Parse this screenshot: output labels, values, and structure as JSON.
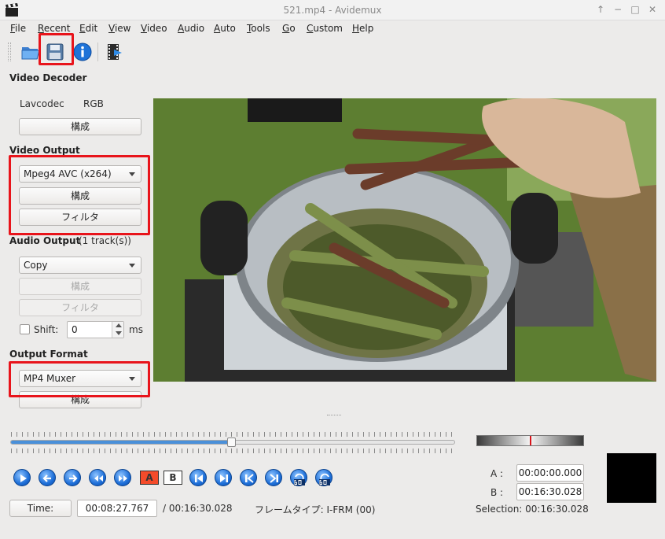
{
  "window": {
    "title": "521.mp4 - Avidemux"
  },
  "menu": [
    {
      "label": "File",
      "u": "F",
      "rest": "ile"
    },
    {
      "label": "Recent",
      "u": "R",
      "rest": "ecent"
    },
    {
      "label": "Edit",
      "u": "E",
      "rest": "dit"
    },
    {
      "label": "View",
      "u": "V",
      "rest": "iew"
    },
    {
      "label": "Video",
      "u": "V",
      "rest": "ideo"
    },
    {
      "label": "Audio",
      "u": "A",
      "rest": "udio"
    },
    {
      "label": "Auto",
      "u": "A",
      "rest": "uto"
    },
    {
      "label": "Tools",
      "u": "T",
      "rest": "ools"
    },
    {
      "label": "Go",
      "u": "G",
      "rest": "o"
    },
    {
      "label": "Custom",
      "u": "C",
      "rest": "ustom"
    },
    {
      "label": "Help",
      "u": "H",
      "rest": "elp"
    }
  ],
  "toolbar": [
    "open-folder-icon",
    "save-icon",
    "info-icon",
    "film-script-icon"
  ],
  "video_decoder": {
    "heading": "Video Decoder",
    "codec": "Lavcodec",
    "format": "RGB",
    "config_label": "構成"
  },
  "video_output": {
    "heading": "Video Output",
    "codec": "Mpeg4 AVC (x264)",
    "config_label": "構成",
    "filter_label": "フィルタ"
  },
  "audio_output": {
    "heading": "Audio Output",
    "tracks": "(1 track(s))",
    "codec": "Copy",
    "config_label": "構成",
    "filter_label": "フィルタ",
    "shift_label": "Shift:",
    "shift_value": "0",
    "shift_unit": "ms"
  },
  "output_format": {
    "heading": "Output Format",
    "muxer": "MP4 Muxer",
    "config_label": "構成"
  },
  "timeline": {
    "position_fraction": 0.5
  },
  "status": {
    "time_button": "Time:",
    "current_time": "00:08:27.767",
    "total_time": "/ 00:16:30.028",
    "frame_type": "フレームタイプ:  I-FRM (00)"
  },
  "markers": {
    "a_label": "A :",
    "a_value": "00:00:00.000",
    "b_label": "B :",
    "b_value": "00:16:30.028",
    "selection": "Selection: 00:16:30.028"
  },
  "colors": {
    "highlight_box": "#e8141b",
    "slider_fill": "#4a90d9"
  }
}
